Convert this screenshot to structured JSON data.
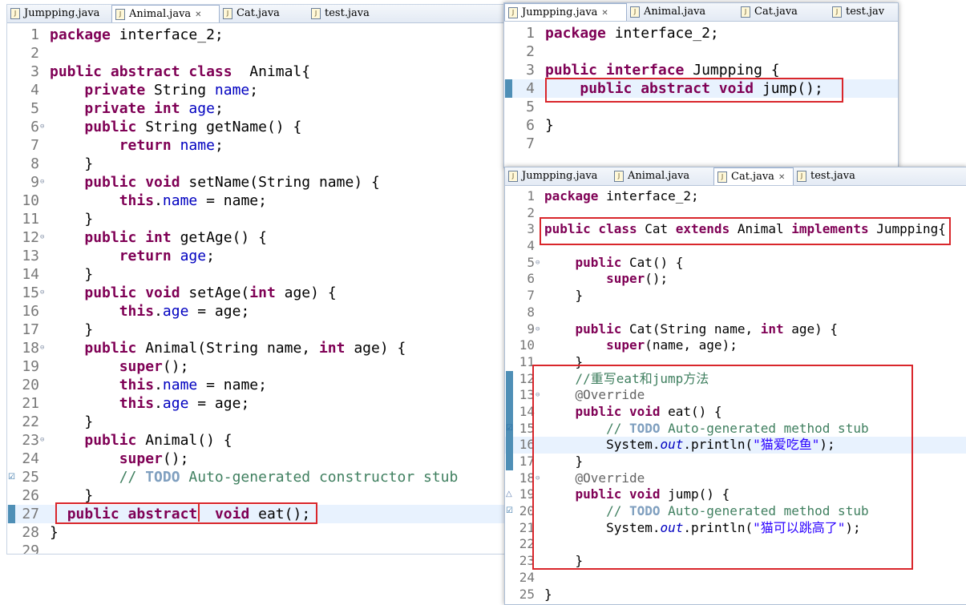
{
  "animal_editor": {
    "tabs": [
      {
        "label": "Jumpping.java"
      },
      {
        "label": "Animal.java",
        "close": "✕"
      },
      {
        "label": "Cat.java"
      },
      {
        "label": "test.java"
      }
    ],
    "lines": [
      {
        "n": "1",
        "t": [
          {
            "c": "kw",
            "s": "package"
          },
          {
            "s": " interface_2;"
          }
        ]
      },
      {
        "n": "2",
        "t": []
      },
      {
        "n": "3",
        "t": [
          {
            "c": "kw",
            "s": "public abstract class"
          },
          {
            "s": "  Animal{"
          }
        ]
      },
      {
        "n": "4",
        "t": [
          {
            "s": "    "
          },
          {
            "c": "kw",
            "s": "private"
          },
          {
            "s": " String "
          },
          {
            "c": "fld",
            "s": "name"
          },
          {
            "s": ";"
          }
        ]
      },
      {
        "n": "5",
        "t": [
          {
            "s": "    "
          },
          {
            "c": "kw",
            "s": "private int"
          },
          {
            "s": " "
          },
          {
            "c": "fld",
            "s": "age"
          },
          {
            "s": ";"
          }
        ]
      },
      {
        "n": "6",
        "fold": true,
        "t": [
          {
            "s": "    "
          },
          {
            "c": "kw",
            "s": "public"
          },
          {
            "s": " String getName() {"
          }
        ]
      },
      {
        "n": "7",
        "t": [
          {
            "s": "        "
          },
          {
            "c": "kw",
            "s": "return"
          },
          {
            "s": " "
          },
          {
            "c": "fld",
            "s": "name"
          },
          {
            "s": ";"
          }
        ]
      },
      {
        "n": "8",
        "t": [
          {
            "s": "    }"
          }
        ]
      },
      {
        "n": "9",
        "fold": true,
        "t": [
          {
            "s": "    "
          },
          {
            "c": "kw",
            "s": "public void"
          },
          {
            "s": " setName(String name) {"
          }
        ]
      },
      {
        "n": "10",
        "t": [
          {
            "s": "        "
          },
          {
            "c": "kw",
            "s": "this"
          },
          {
            "s": "."
          },
          {
            "c": "fld",
            "s": "name"
          },
          {
            "s": " = name;"
          }
        ]
      },
      {
        "n": "11",
        "t": [
          {
            "s": "    }"
          }
        ]
      },
      {
        "n": "12",
        "fold": true,
        "t": [
          {
            "s": "    "
          },
          {
            "c": "kw",
            "s": "public int"
          },
          {
            "s": " getAge() {"
          }
        ]
      },
      {
        "n": "13",
        "t": [
          {
            "s": "        "
          },
          {
            "c": "kw",
            "s": "return"
          },
          {
            "s": " "
          },
          {
            "c": "fld",
            "s": "age"
          },
          {
            "s": ";"
          }
        ]
      },
      {
        "n": "14",
        "t": [
          {
            "s": "    }"
          }
        ]
      },
      {
        "n": "15",
        "fold": true,
        "t": [
          {
            "s": "    "
          },
          {
            "c": "kw",
            "s": "public void"
          },
          {
            "s": " setAge("
          },
          {
            "c": "kw",
            "s": "int"
          },
          {
            "s": " age) {"
          }
        ]
      },
      {
        "n": "16",
        "t": [
          {
            "s": "        "
          },
          {
            "c": "kw",
            "s": "this"
          },
          {
            "s": "."
          },
          {
            "c": "fld",
            "s": "age"
          },
          {
            "s": " = age;"
          }
        ]
      },
      {
        "n": "17",
        "t": [
          {
            "s": "    }"
          }
        ]
      },
      {
        "n": "18",
        "fold": true,
        "t": [
          {
            "s": "    "
          },
          {
            "c": "kw",
            "s": "public"
          },
          {
            "s": " Animal(String name, "
          },
          {
            "c": "kw",
            "s": "int"
          },
          {
            "s": " age) {"
          }
        ]
      },
      {
        "n": "19",
        "t": [
          {
            "s": "        "
          },
          {
            "c": "kw",
            "s": "super"
          },
          {
            "s": "();"
          }
        ]
      },
      {
        "n": "20",
        "t": [
          {
            "s": "        "
          },
          {
            "c": "kw",
            "s": "this"
          },
          {
            "s": "."
          },
          {
            "c": "fld",
            "s": "name"
          },
          {
            "s": " = name;"
          }
        ]
      },
      {
        "n": "21",
        "t": [
          {
            "s": "        "
          },
          {
            "c": "kw",
            "s": "this"
          },
          {
            "s": "."
          },
          {
            "c": "fld",
            "s": "age"
          },
          {
            "s": " = age;"
          }
        ]
      },
      {
        "n": "22",
        "t": [
          {
            "s": "    }"
          }
        ]
      },
      {
        "n": "23",
        "fold": true,
        "t": [
          {
            "s": "    "
          },
          {
            "c": "kw",
            "s": "public"
          },
          {
            "s": " Animal() {"
          }
        ]
      },
      {
        "n": "24",
        "t": [
          {
            "s": "        "
          },
          {
            "c": "kw",
            "s": "super"
          },
          {
            "s": "();"
          }
        ]
      },
      {
        "n": "25",
        "task": true,
        "t": [
          {
            "s": "        "
          },
          {
            "c": "cmt",
            "s": "// "
          },
          {
            "c": "todo",
            "s": "TODO"
          },
          {
            "c": "cmt",
            "s": " Auto-generated constructor stub"
          }
        ]
      },
      {
        "n": "26",
        "t": [
          {
            "s": "    }"
          }
        ]
      },
      {
        "n": "27",
        "hl": true,
        "mark": true,
        "t": [
          {
            "s": "  "
          },
          {
            "c": "kw",
            "s": "public abstract"
          },
          {
            "s": "  "
          },
          {
            "c": "kw",
            "s": "void"
          },
          {
            "s": " eat();"
          }
        ]
      },
      {
        "n": "28",
        "t": [
          {
            "s": "}"
          }
        ]
      },
      {
        "n": "29",
        "t": []
      }
    ]
  },
  "jumpping_editor": {
    "tabs": [
      {
        "label": "Jumpping.java",
        "close": "✕"
      },
      {
        "label": "Animal.java"
      },
      {
        "label": "Cat.java"
      },
      {
        "label": "test.jav"
      }
    ],
    "lines": [
      {
        "n": "1",
        "t": [
          {
            "c": "kw",
            "s": "package"
          },
          {
            "s": " interface_2;"
          }
        ]
      },
      {
        "n": "2",
        "t": []
      },
      {
        "n": "3",
        "t": [
          {
            "c": "kw",
            "s": "public interface"
          },
          {
            "s": " Jumpping {"
          }
        ]
      },
      {
        "n": "4",
        "hl": true,
        "mark": true,
        "t": [
          {
            "s": "    "
          },
          {
            "c": "kw",
            "s": "public abstract void"
          },
          {
            "s": " jump();"
          }
        ]
      },
      {
        "n": "5",
        "t": []
      },
      {
        "n": "6",
        "t": [
          {
            "s": "}"
          }
        ]
      },
      {
        "n": "7",
        "t": []
      }
    ]
  },
  "cat_editor": {
    "tabs": [
      {
        "label": "Jumpping.java"
      },
      {
        "label": "Animal.java"
      },
      {
        "label": "Cat.java",
        "close": "✕"
      },
      {
        "label": "test.java"
      }
    ],
    "lines": [
      {
        "n": "1",
        "t": [
          {
            "c": "kw",
            "s": "package"
          },
          {
            "s": " interface_2;"
          }
        ]
      },
      {
        "n": "2",
        "t": []
      },
      {
        "n": "3",
        "t": [
          {
            "c": "kw",
            "s": "public class"
          },
          {
            "s": " Cat "
          },
          {
            "c": "kw",
            "s": "extends"
          },
          {
            "s": " Animal "
          },
          {
            "c": "kw",
            "s": "implements"
          },
          {
            "s": " Jumpping{"
          }
        ]
      },
      {
        "n": "4",
        "t": []
      },
      {
        "n": "5",
        "fold": true,
        "t": [
          {
            "s": "    "
          },
          {
            "c": "kw",
            "s": "public"
          },
          {
            "s": " Cat() {"
          }
        ]
      },
      {
        "n": "6",
        "t": [
          {
            "s": "        "
          },
          {
            "c": "kw",
            "s": "super"
          },
          {
            "s": "();"
          }
        ]
      },
      {
        "n": "7",
        "t": [
          {
            "s": "    }"
          }
        ]
      },
      {
        "n": "8",
        "t": []
      },
      {
        "n": "9",
        "fold": true,
        "t": [
          {
            "s": "    "
          },
          {
            "c": "kw",
            "s": "public"
          },
          {
            "s": " Cat(String name, "
          },
          {
            "c": "kw",
            "s": "int"
          },
          {
            "s": " age) {"
          }
        ]
      },
      {
        "n": "10",
        "t": [
          {
            "s": "        "
          },
          {
            "c": "kw",
            "s": "super"
          },
          {
            "s": "(name, age);"
          }
        ]
      },
      {
        "n": "11",
        "t": [
          {
            "s": "    }"
          }
        ]
      },
      {
        "n": "12",
        "mark": true,
        "t": [
          {
            "s": "    "
          },
          {
            "c": "cmt",
            "s": "//重写eat和jump方法"
          }
        ]
      },
      {
        "n": "13",
        "fold": true,
        "mark": true,
        "t": [
          {
            "s": "    "
          },
          {
            "c": "ann",
            "s": "@Override"
          }
        ]
      },
      {
        "n": "14",
        "mark": true,
        "t": [
          {
            "s": "    "
          },
          {
            "c": "kw",
            "s": "public void"
          },
          {
            "s": " eat() {"
          }
        ]
      },
      {
        "n": "15",
        "task": true,
        "mark": true,
        "t": [
          {
            "s": "        "
          },
          {
            "c": "cmt",
            "s": "// "
          },
          {
            "c": "todo",
            "s": "TODO"
          },
          {
            "c": "cmt",
            "s": " Auto-generated method stub"
          }
        ]
      },
      {
        "n": "16",
        "hl": true,
        "mark": true,
        "t": [
          {
            "s": "        System."
          },
          {
            "c": "sfld",
            "s": "out"
          },
          {
            "s": ".println("
          },
          {
            "c": "str",
            "s": "\"猫爱吃鱼\""
          },
          {
            "s": ");"
          }
        ]
      },
      {
        "n": "17",
        "mark": true,
        "t": [
          {
            "s": "    }"
          }
        ]
      },
      {
        "n": "18",
        "fold": true,
        "t": [
          {
            "s": "    "
          },
          {
            "c": "ann",
            "s": "@Override"
          }
        ]
      },
      {
        "n": "19",
        "tri": true,
        "t": [
          {
            "s": "    "
          },
          {
            "c": "kw",
            "s": "public void"
          },
          {
            "s": " jump() {"
          }
        ]
      },
      {
        "n": "20",
        "task": true,
        "t": [
          {
            "s": "        "
          },
          {
            "c": "cmt",
            "s": "// "
          },
          {
            "c": "todo",
            "s": "TODO"
          },
          {
            "c": "cmt",
            "s": " Auto-generated method stub"
          }
        ]
      },
      {
        "n": "21",
        "t": [
          {
            "s": "        System."
          },
          {
            "c": "sfld",
            "s": "out"
          },
          {
            "s": ".println("
          },
          {
            "c": "str",
            "s": "\"猫可以跳高了\""
          },
          {
            "s": ");"
          }
        ]
      },
      {
        "n": "22",
        "t": []
      },
      {
        "n": "23",
        "t": [
          {
            "s": "    }"
          }
        ]
      },
      {
        "n": "24",
        "t": []
      },
      {
        "n": "25",
        "t": [
          {
            "s": "}"
          }
        ]
      }
    ]
  },
  "colors": {
    "keyword": "#7f0055",
    "field": "#0000c0",
    "comment": "#3f7f5f",
    "string": "#2a00ff",
    "highlight": "#e8f2fe",
    "red_box": "#d9262b"
  }
}
